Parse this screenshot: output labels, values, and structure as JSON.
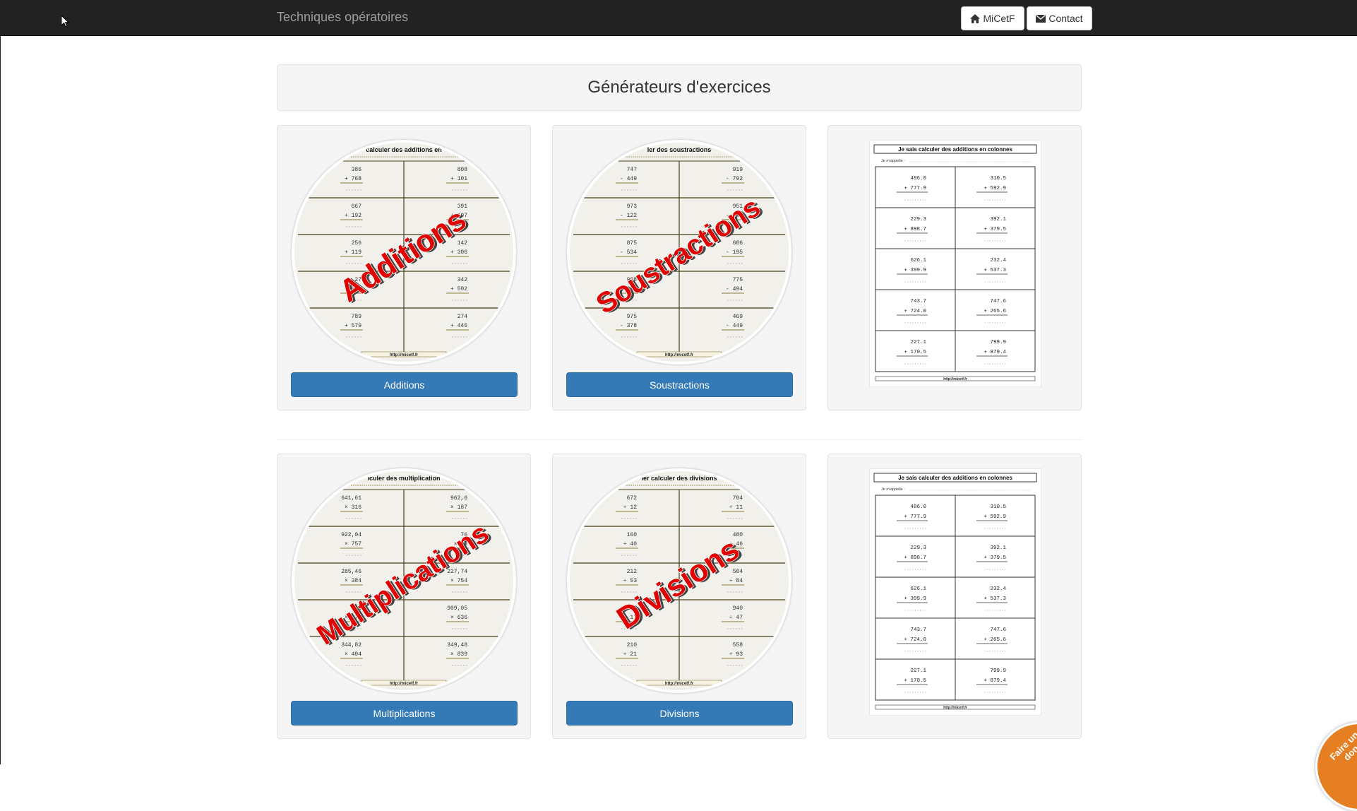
{
  "navbar": {
    "brand": "Techniques opératoires",
    "home_label": "MiCetF",
    "contact_label": "Contact"
  },
  "main": {
    "title": "Générateurs d'exercices"
  },
  "cards": [
    {
      "overlay": "Additions",
      "button": "Additions",
      "sheet_header": "calculer des additions en",
      "op": "+",
      "rows": [
        [
          "386",
          "768"
        ],
        [
          "808",
          "101"
        ],
        [
          "667",
          "192"
        ],
        [
          "391",
          "197"
        ],
        [
          "256",
          "119"
        ],
        [
          "142",
          "306"
        ],
        [
          "27",
          "336"
        ],
        [
          "342",
          "502"
        ],
        [
          "789",
          "579"
        ],
        [
          "274",
          "446"
        ]
      ]
    },
    {
      "overlay": "Soustractions",
      "button": "Soustractions",
      "sheet_header": "ler des soustractions",
      "op": "-",
      "rows": [
        [
          "747",
          "449"
        ],
        [
          "919",
          "792"
        ],
        [
          "973",
          "122"
        ],
        [
          "951",
          "444"
        ],
        [
          "875",
          "534"
        ],
        [
          "686",
          "195"
        ],
        [
          "908",
          "134"
        ],
        [
          "775",
          "494"
        ],
        [
          "975",
          "378"
        ],
        [
          "469",
          "449"
        ]
      ]
    },
    {
      "overlay": "Multiplications",
      "button": "Multiplications",
      "sheet_header": "lculer des multiplication",
      "op": "×",
      "rows": [
        [
          "641,61",
          "316"
        ],
        [
          "962,6",
          "187"
        ],
        [
          "922,04",
          "757"
        ],
        [
          "76",
          "69"
        ],
        [
          "285,46",
          "384"
        ],
        [
          "227,74",
          "754"
        ],
        [
          "3",
          "673"
        ],
        [
          "909,05",
          "636"
        ],
        [
          "344,82",
          "404"
        ],
        [
          "349,48",
          "839"
        ]
      ]
    },
    {
      "overlay": "Divisions",
      "button": "Divisions",
      "sheet_header": "ler calculer des divisions",
      "op": "÷",
      "rows": [
        [
          "672",
          "12"
        ],
        [
          "704",
          "11"
        ],
        [
          "160",
          "40"
        ],
        [
          "480",
          "46"
        ],
        [
          "212",
          "53"
        ],
        [
          "504",
          "84"
        ],
        [
          "153",
          "17"
        ],
        [
          "940",
          "47"
        ],
        [
          "210",
          "21"
        ],
        [
          "558",
          "93"
        ]
      ]
    }
  ],
  "sample_sheet": {
    "title": "Je sais calculer des additions en colonnes",
    "name_label": "Je m'appelle :",
    "rows": [
      [
        "486.0",
        "777.9",
        "310.5",
        "592.9"
      ],
      [
        "229.3",
        "898.7",
        "392.1",
        "379.5"
      ],
      [
        "626.1",
        "399.9",
        "232.4",
        "537.3"
      ],
      [
        "743.7",
        "724.0",
        "747.6",
        "265.6"
      ],
      [
        "227.1",
        "170.5",
        "799.9",
        "879.4"
      ]
    ],
    "footer": "http://micetf.fr"
  },
  "donate": "Faire un don"
}
